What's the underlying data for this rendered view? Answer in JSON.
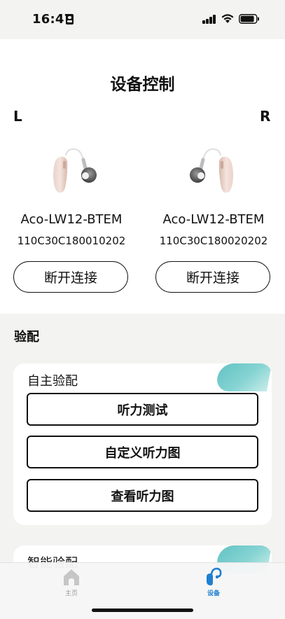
{
  "status_bar": {
    "time": "16:47"
  },
  "header": {
    "title": "设备控制"
  },
  "devices": {
    "left": {
      "side": "L",
      "model": "Aco-LW12-BTEM",
      "serial": "110C30C180010202",
      "disconnect_label": "断开连接"
    },
    "right": {
      "side": "R",
      "model": "Aco-LW12-BTEM",
      "serial": "110C30C180020202",
      "disconnect_label": "断开连接"
    }
  },
  "fitting": {
    "section_title": "验配",
    "self_fitting": {
      "label": "自主验配",
      "actions": [
        "听力测试",
        "自定义听力图",
        "查看听力图"
      ]
    },
    "smart_fitting": {
      "label": "智能验配"
    }
  },
  "tab_bar": {
    "tabs": [
      {
        "label": "主页",
        "icon": "home-icon",
        "active": false
      },
      {
        "label": "设备",
        "icon": "hearing-aid-icon",
        "active": true
      }
    ],
    "active_color": "#1f7fd0",
    "inactive_color": "#9a9a9a"
  },
  "colors": {
    "background": "#f3f3f1",
    "card": "#ffffff",
    "accent_teal": "#64c3c4"
  }
}
